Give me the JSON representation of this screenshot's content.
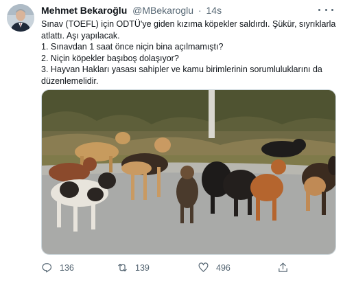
{
  "author": {
    "name": "Mehmet Bekaroğlu",
    "handle": "@MBekaroglu",
    "separator": "·",
    "time": "14s"
  },
  "tweet": {
    "lines": [
      "Sınav (TOEFL) için ODTÜ'ye giden kızıma köpekler saldırdı. Şükür, sıyrıklarla",
      "atlattı. Aşı yapılacak.",
      "1. Sınavdan 1 saat önce niçin bina açılmamıştı?",
      "2. Niçin köpekler başıboş dolaşıyor?",
      "3. Hayvan Hakları yasası sahipler ve kamu birimlerinin sorumluluklarını da",
      "düzenlemelidir."
    ]
  },
  "media": {
    "description_icon": "photo-of-stray-dogs"
  },
  "actions": {
    "replies": "136",
    "retweets": "139",
    "likes": "496"
  },
  "icons": {
    "reply": "reply-icon",
    "retweet": "retweet-icon",
    "like": "heart-icon",
    "share": "share-icon",
    "more": "more-icon"
  },
  "colors": {
    "secondary_text": "#536471",
    "primary_text": "#0f1419"
  }
}
